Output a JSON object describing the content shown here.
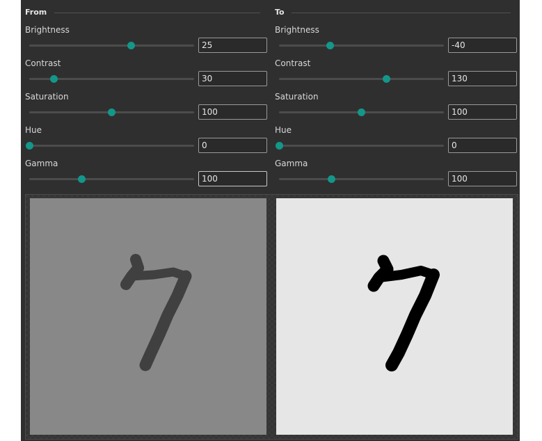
{
  "groups": {
    "from": {
      "title": "From",
      "controls": [
        {
          "label": "Brightness",
          "value": "25",
          "fraction": 0.62
        },
        {
          "label": "Contrast",
          "value": "30",
          "fraction": 0.15
        },
        {
          "label": "Saturation",
          "value": "100",
          "fraction": 0.5
        },
        {
          "label": "Hue",
          "value": "0",
          "fraction": 0.0
        },
        {
          "label": "Gamma",
          "value": "100",
          "fraction": 0.32
        }
      ]
    },
    "to": {
      "title": "To",
      "controls": [
        {
          "label": "Brightness",
          "value": "-40",
          "fraction": 0.31
        },
        {
          "label": "Contrast",
          "value": "130",
          "fraction": 0.65
        },
        {
          "label": "Saturation",
          "value": "100",
          "fraction": 0.5
        },
        {
          "label": "Hue",
          "value": "0",
          "fraction": 0.0
        },
        {
          "label": "Gamma",
          "value": "100",
          "fraction": 0.32
        }
      ]
    }
  },
  "colors": {
    "panel_bg": "#2f2f2f",
    "accent": "#14968a",
    "from_image_bg": "#888888",
    "from_image_ink": "#404040",
    "to_image_bg": "#e6e6e6",
    "to_image_ink": "#000000"
  }
}
